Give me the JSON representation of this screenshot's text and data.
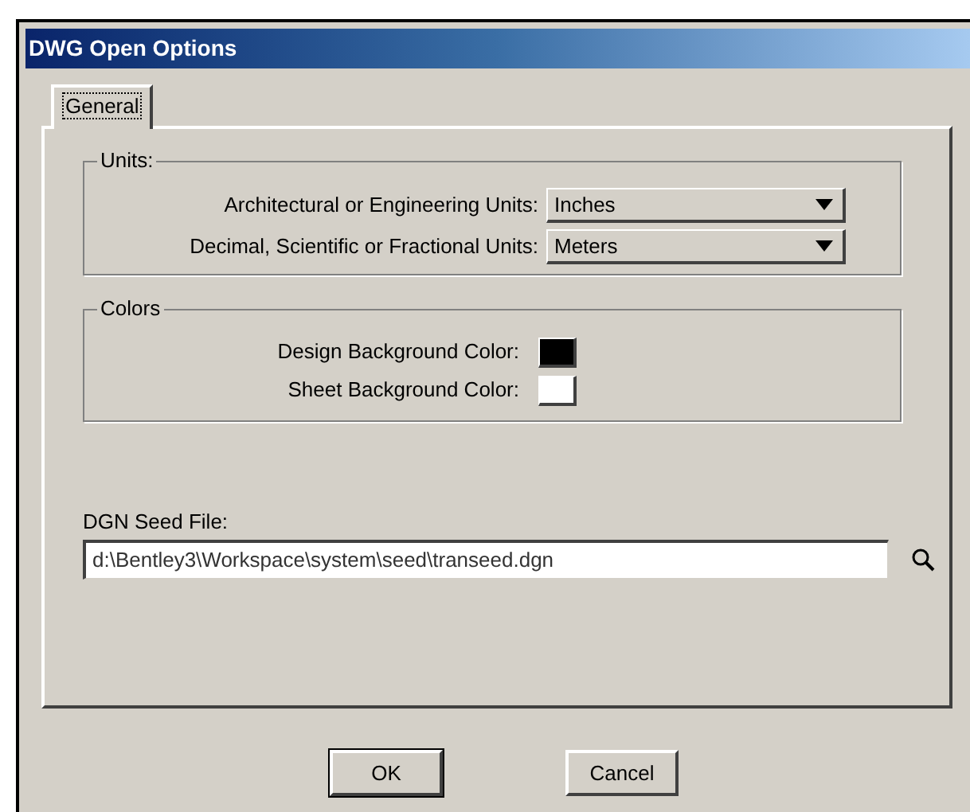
{
  "window": {
    "title": "DWG Open Options"
  },
  "tabs": [
    {
      "label": "General",
      "selected": true
    }
  ],
  "units": {
    "title": "Units:",
    "rows": [
      {
        "label": "Architectural or Engineering Units:",
        "value": "Inches"
      },
      {
        "label": "Decimal, Scientific or Fractional Units:",
        "value": "Meters"
      }
    ]
  },
  "colors": {
    "title": "Colors",
    "rows": [
      {
        "label": "Design Background Color:",
        "color": "#000000"
      },
      {
        "label": "Sheet Background Color:",
        "color": "#ffffff"
      }
    ]
  },
  "seed_file": {
    "label": "DGN Seed File:",
    "value": "d:\\Bentley3\\Workspace\\system\\seed\\transeed.dgn"
  },
  "buttons": [
    "OK",
    "Cancel"
  ]
}
